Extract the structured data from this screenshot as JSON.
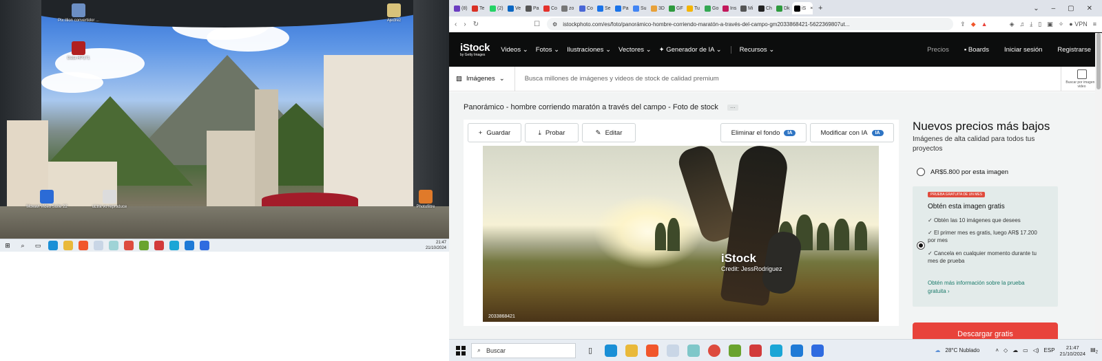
{
  "desktop": {
    "icons": [
      {
        "label": "Pix illion convertidor ...",
        "icon": "image-app-icon",
        "color": "#6c8fc4"
      },
      {
        "label": "Data HP171",
        "icon": "app-icon",
        "color": "#b12020"
      },
      {
        "label": "Ajedrez",
        "icon": "chess-icon",
        "color": "#d8c27a"
      },
      {
        "label": "Movavi Video Suite 22",
        "icon": "movavi-icon",
        "color": "#2b6bd6"
      },
      {
        "label": "uLtra vo reproduce",
        "icon": "doc-icon",
        "color": "#dcdcdc"
      },
      {
        "label": "Photofiltre",
        "icon": "photofiltre-icon",
        "color": "#e07a2a"
      }
    ],
    "clock_time": "21:47",
    "clock_date": "21/10/2024"
  },
  "browser": {
    "tabs": [
      {
        "label": "(8)",
        "color": "#6c3ec1"
      },
      {
        "label": "Te",
        "color": "#d93025"
      },
      {
        "label": "(2)",
        "color": "#25d366"
      },
      {
        "label": "Ve",
        "color": "#0a66c2"
      },
      {
        "label": "Pa",
        "color": "#555555"
      },
      {
        "label": "Co",
        "color": "#e4312b"
      },
      {
        "label": "zo",
        "color": "#777777"
      },
      {
        "label": "Co",
        "color": "#4a67d6"
      },
      {
        "label": "Se",
        "color": "#1a73e8"
      },
      {
        "label": "Pa",
        "color": "#1a73e8"
      },
      {
        "label": "Su",
        "color": "#4285f4"
      },
      {
        "label": "3D",
        "color": "#e8a13a"
      },
      {
        "label": "GF",
        "color": "#2e9a3e"
      },
      {
        "label": "Tu",
        "color": "#f4b400"
      },
      {
        "label": "Go",
        "color": "#34a853"
      },
      {
        "label": "Ins",
        "color": "#c2185b"
      },
      {
        "label": "Mi",
        "color": "#555555"
      },
      {
        "label": "Ch",
        "color": "#222222"
      },
      {
        "label": "Dk",
        "color": "#2e9a3e"
      },
      {
        "label": "iS",
        "color": "#000000",
        "active": true
      }
    ],
    "new_tab_label": "+",
    "url": "istockphoto.com/es/foto/panorámico-hombre-corriendo-maratón-a-través-del-campo-gm2033868421-5622369807ut...",
    "vpn_label": "VPN"
  },
  "istock": {
    "logo_main": "iStock",
    "logo_sub": "by Getty Images",
    "nav": [
      "Videos",
      "Fotos",
      "Ilustraciones",
      "Vectores",
      "Generador de IA",
      "Recursos"
    ],
    "nav_right": {
      "pricing": "Precios",
      "boards": "Boards",
      "login": "Iniciar sesión",
      "register": "Registrarse"
    },
    "search": {
      "category": "Imágenes",
      "placeholder": "Busca millones de imágenes y videos de stock de calidad premium",
      "visual_search": "Buscar por imagen o video"
    },
    "title": "Panorámico - hombre corriendo maratón a través del campo - Foto de stock",
    "more_label": "···",
    "actions": {
      "save": "Guardar",
      "try": "Probar",
      "edit": "Editar",
      "remove_bg": "Eliminar el fondo",
      "modify_ai": "Modificar con IA",
      "ai_badge": "IA"
    },
    "watermark": {
      "brand": "iStock",
      "credit": "Credit: JessRodriguez"
    },
    "image_id": "2033868421",
    "panel": {
      "heading": "Nuevos precios más bajos",
      "subheading": "Imágenes de alta calidad para todos tus proyectos",
      "option_single": "AR$5.800 por esta imagen",
      "trial_badge": "PRUEBA GRATUITA DE UN MES",
      "trial_title": "Obtén esta imagen gratis",
      "bullets": [
        "Obtén las 10 imágenes que desees",
        "El primer mes es gratis, luego AR$ 17.200 por mes",
        "Cancela en cualquier momento durante tu mes de prueba"
      ],
      "trial_more": "Obtén más información sobre la prueba gratuita ›",
      "cta": "Descargar gratis"
    }
  },
  "taskbar": {
    "search_placeholder": "Buscar",
    "weather": "28°C  Nublado",
    "language": "ESP",
    "time": "21:47",
    "date": "21/10/2024",
    "notif_count": "2"
  }
}
